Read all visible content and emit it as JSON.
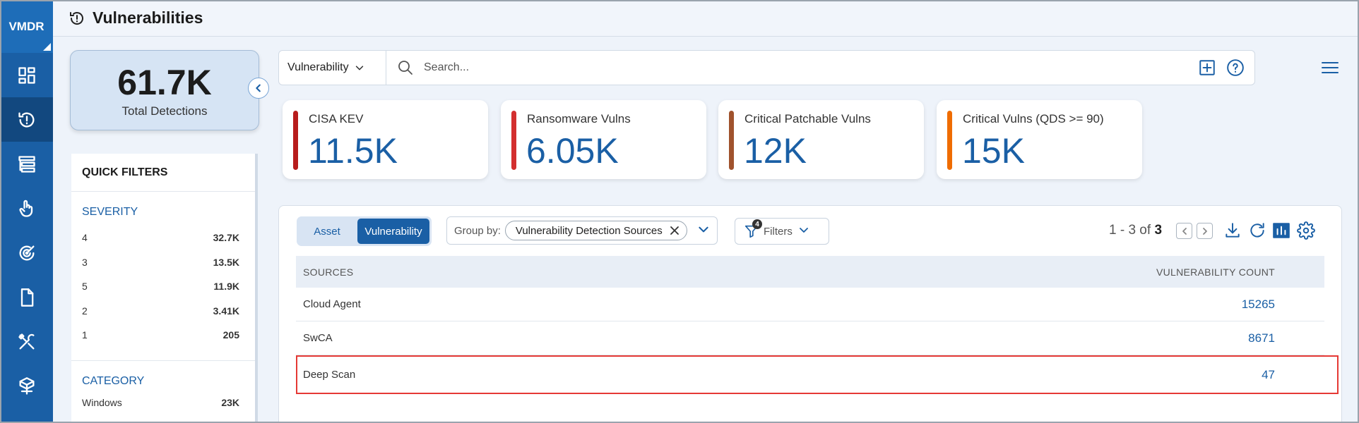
{
  "app": {
    "brand": "VMDR"
  },
  "header": {
    "title": "Vulnerabilities"
  },
  "total": {
    "value": "61.7K",
    "label": "Total Detections"
  },
  "quick_filters": {
    "title": "QUICK FILTERS",
    "severity": {
      "title": "SEVERITY",
      "items": [
        {
          "label": "4",
          "count": "32.7K"
        },
        {
          "label": "3",
          "count": "13.5K"
        },
        {
          "label": "5",
          "count": "11.9K"
        },
        {
          "label": "2",
          "count": "3.41K"
        },
        {
          "label": "1",
          "count": "205"
        }
      ]
    },
    "category": {
      "title": "CATEGORY",
      "items": [
        {
          "label": "Windows",
          "count": "23K"
        }
      ]
    }
  },
  "search": {
    "type": "Vulnerability",
    "placeholder": "Search..."
  },
  "stats": [
    {
      "label": "CISA KEV",
      "value": "11.5K",
      "color": "#b71c1c"
    },
    {
      "label": "Ransomware Vulns",
      "value": "6.05K",
      "color": "#d32f2f"
    },
    {
      "label": "Critical Patchable Vulns",
      "value": "12K",
      "color": "#a0522d"
    },
    {
      "label": "Critical Vulns (QDS >= 90)",
      "value": "15K",
      "color": "#ef6c00"
    }
  ],
  "toolbar": {
    "toggle": {
      "asset": "Asset",
      "vulnerability": "Vulnerability"
    },
    "group_by_label": "Group by:",
    "group_by_value": "Vulnerability Detection Sources",
    "filters_label": "Filters",
    "filters_count": "4",
    "pager_text": "1 - 3 of",
    "pager_total": "3"
  },
  "table": {
    "columns": [
      "SOURCES",
      "VULNERABILITY COUNT"
    ],
    "rows": [
      {
        "source": "Cloud Agent",
        "count": "15265"
      },
      {
        "source": "SwCA",
        "count": "8671"
      },
      {
        "source": "Deep Scan",
        "count": "47"
      }
    ]
  }
}
